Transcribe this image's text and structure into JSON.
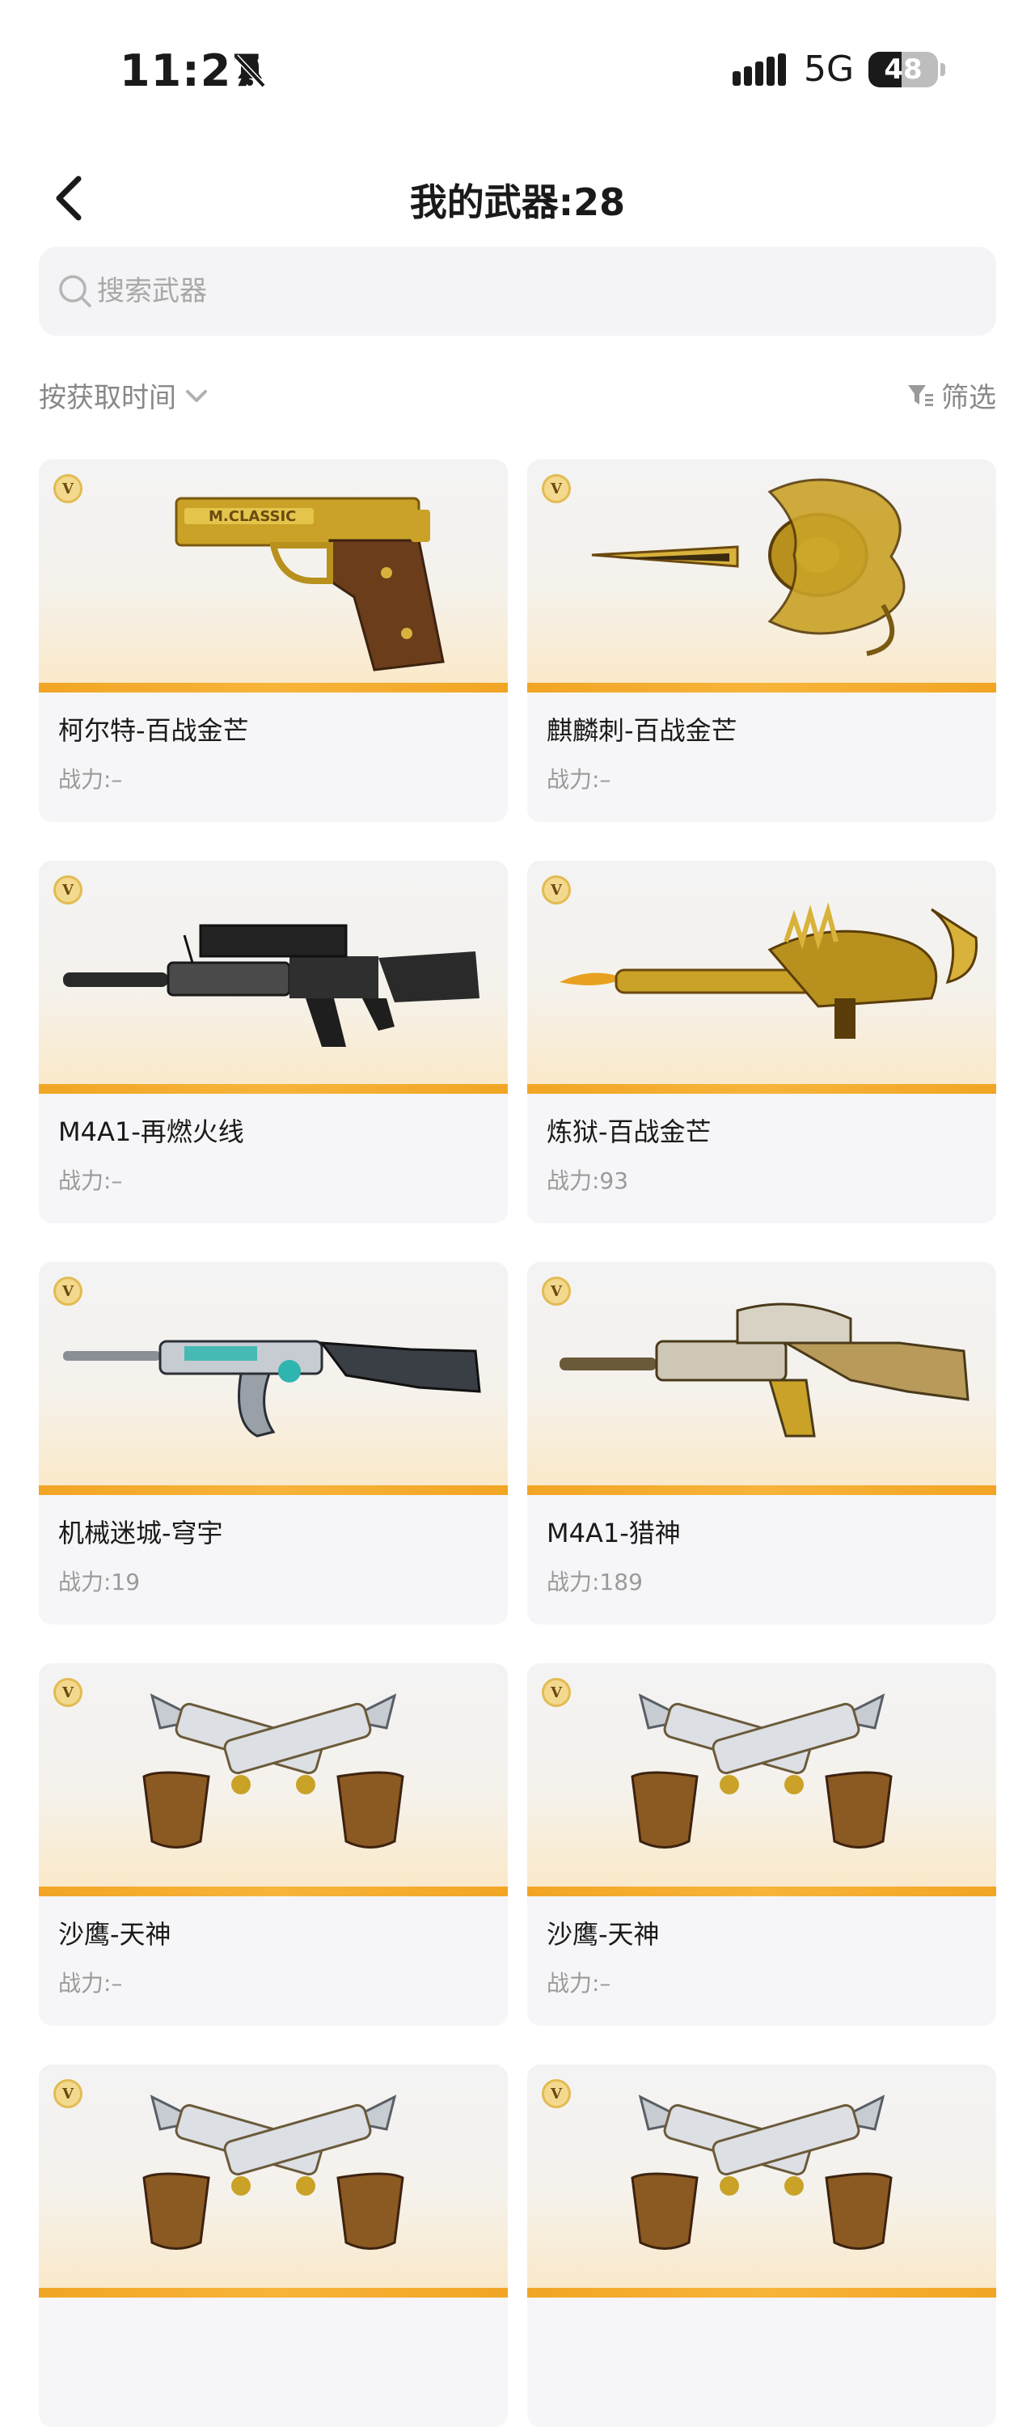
{
  "status": {
    "time": "11:27",
    "network": "5G",
    "battery": "48",
    "battery_level": 0.48
  },
  "nav": {
    "title": "我的武器:28"
  },
  "search": {
    "placeholder": "搜索武器"
  },
  "toolbar": {
    "sort_label": "按获取时间",
    "filter_label": "筛选"
  },
  "badge_letter": "V",
  "weapons": [
    {
      "name": "柯尔特-百战金芒",
      "power": "战力:–",
      "art": "pistol-gold"
    },
    {
      "name": "麒麟刺-百战金芒",
      "power": "战力:–",
      "art": "blade-gold"
    },
    {
      "name": "M4A1-再燃火线",
      "power": "战力:–",
      "art": "rifle-black"
    },
    {
      "name": "炼狱-百战金芒",
      "power": "战力:93",
      "art": "gatling-gold"
    },
    {
      "name": "机械迷城-穹宇",
      "power": "战力:19",
      "art": "ak-silver"
    },
    {
      "name": "M4A1-猎神",
      "power": "战力:189",
      "art": "rifle-silver"
    },
    {
      "name": "沙鹰-天神",
      "power": "战力:–",
      "art": "dual-eagle"
    },
    {
      "name": "沙鹰-天神",
      "power": "战力:–",
      "art": "dual-eagle"
    },
    {
      "name": "",
      "power": "",
      "art": "dual-eagle"
    },
    {
      "name": "",
      "power": "",
      "art": "dual-eagle"
    }
  ]
}
